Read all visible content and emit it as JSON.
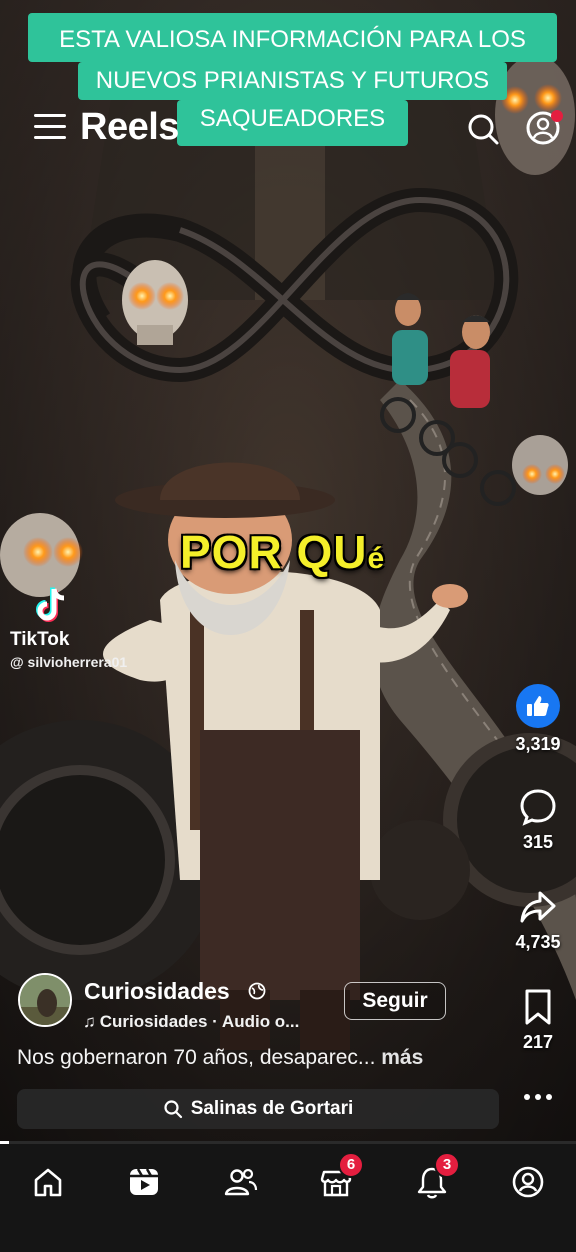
{
  "caption": {
    "line1": "ESTA VALIOSA  INFORMACIÓN  PARA LOS",
    "line2": "NUEVOS PRIANISTAS Y FUTUROS",
    "line3": "SAQUEADORES"
  },
  "header": {
    "title": "Reels",
    "accent_color": "#2fc39a",
    "notification_dot_color": "#e41e3f"
  },
  "video": {
    "subtitle_main": "POR QU",
    "subtitle_small": "é",
    "subtitle_color": "#f4ef2a",
    "watermark_app": "TikTok",
    "watermark_user": "@ silvioherrera01"
  },
  "actions": {
    "likes": "3,319",
    "comments": "315",
    "shares": "4,735",
    "saves": "217",
    "like_color": "#1877f2"
  },
  "post": {
    "channel": "Curiosidades",
    "audio": "Curiosidades · Audio o...",
    "follow_label": "Seguir",
    "description": "Nos gobernaron 70 años, desaparec...",
    "more_label": " más"
  },
  "search": {
    "label": "Salinas de Gortari"
  },
  "progress": {
    "fraction": 0.016
  },
  "nav": {
    "items": [
      {
        "name": "home",
        "badge": ""
      },
      {
        "name": "reels",
        "badge": ""
      },
      {
        "name": "friends",
        "badge": ""
      },
      {
        "name": "marketplace",
        "badge": "6"
      },
      {
        "name": "notifications",
        "badge": "3"
      },
      {
        "name": "profile",
        "badge": ""
      }
    ]
  }
}
